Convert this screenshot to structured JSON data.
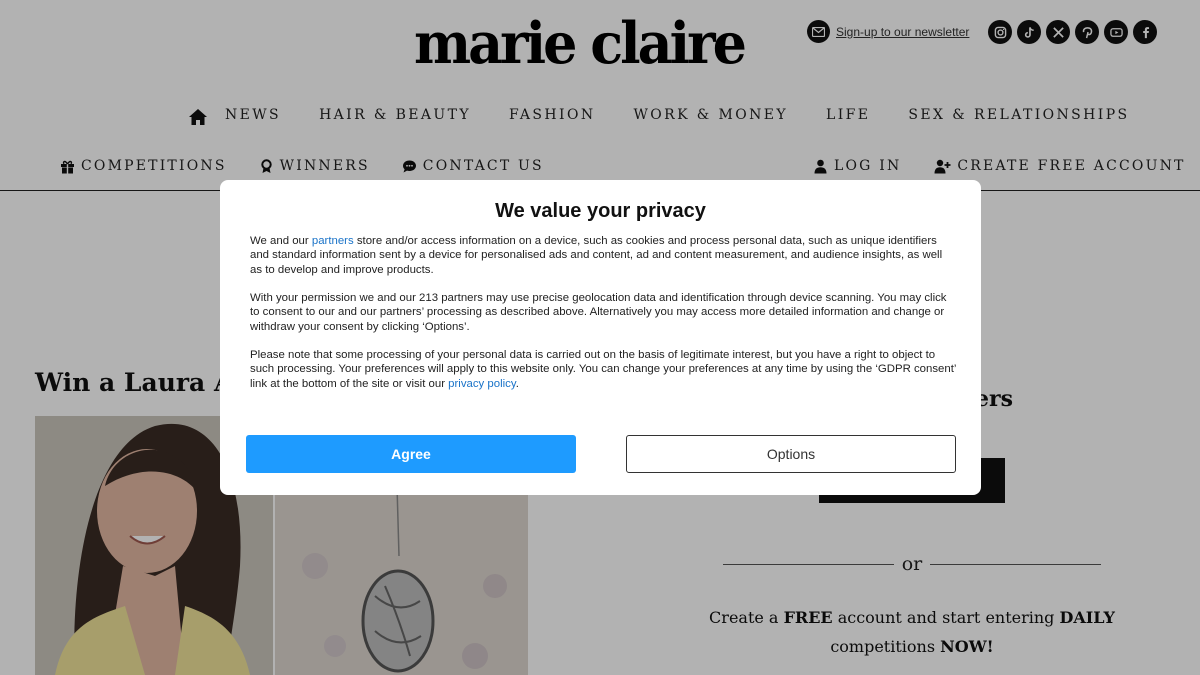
{
  "header": {
    "logo_text": "marie claire",
    "newsletter_label": "Sign-up to our newsletter",
    "socials": [
      "instagram-icon",
      "tiktok-icon",
      "x-icon",
      "pinterest-icon",
      "youtube-icon",
      "facebook-icon"
    ]
  },
  "nav_main": [
    "NEWS",
    "HAIR & BEAUTY",
    "FASHION",
    "WORK & MONEY",
    "LIFE",
    "SEX & RELATIONSHIPS"
  ],
  "nav_sub_left": [
    "COMPETITIONS",
    "WINNERS",
    "CONTACT US"
  ],
  "nav_sub_right": [
    "LOG IN",
    "CREATE FREE ACCOUNT"
  ],
  "page": {
    "competition_title": "Win a Laura As",
    "right_heading_fragment": "ers",
    "or_label": "or",
    "create_prefix": "Create a",
    "create_free": "FREE",
    "create_middle": "account and start entering",
    "create_daily": "DAILY",
    "create_competitions": "competitions",
    "create_now": "NOW!"
  },
  "consent": {
    "title": "We value your privacy",
    "p1_before": "We and our",
    "p1_link": "partners",
    "p1_after": "store and/or access information on a device, such as cookies and process personal data, such as unique identifiers and standard information sent by a device for personalised ads and content, ad and content measurement, and audience insights, as well as to develop and improve products.",
    "p2": "With your permission we and our 213 partners may use precise geolocation data and identification through device scanning. You may click to consent to our and our partners’ processing as described above. Alternatively you may access more detailed information and change or withdraw your consent by clicking ‘Options’.",
    "p3_before": "Please note that some processing of your personal data is carried out on the basis of legitimate interest, but you have a right to object to such processing. Your preferences will apply to this website only. You can change your preferences at any time by using the ‘GDPR consent’ link at the bottom of the site or visit our",
    "p3_link": "privacy policy",
    "p3_after": ".",
    "agree_label": "Agree",
    "options_label": "Options"
  },
  "colors": {
    "agree_button": "#1e9bff",
    "link": "#1a73c8",
    "overlay": "rgba(0,0,0,0.3)"
  }
}
